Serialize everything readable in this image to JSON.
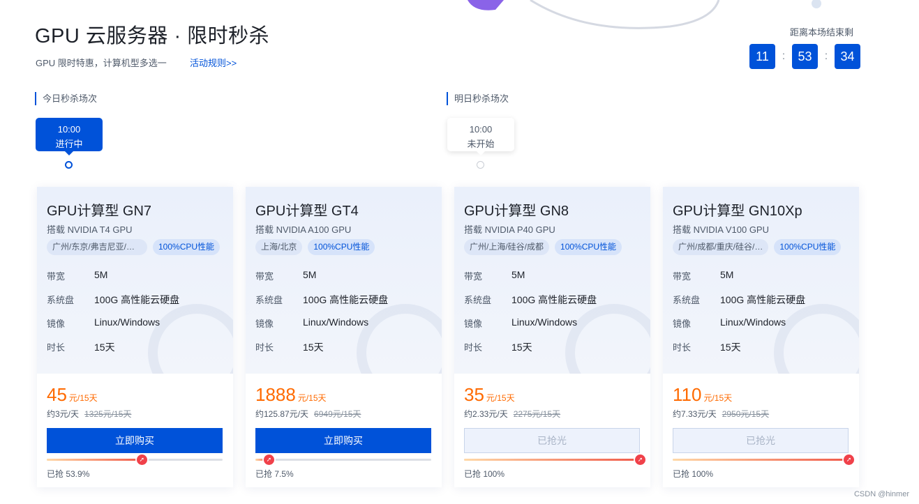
{
  "header": {
    "title": "GPU 云服务器 · 限时秒杀",
    "subtitle": "GPU 限时特惠，计算机型多选一",
    "rules_link": "活动规则>>"
  },
  "countdown": {
    "label": "距离本场结束剩",
    "hours": "11",
    "minutes": "53",
    "seconds": "34",
    "separator": ":"
  },
  "sessions": [
    {
      "label": "今日秒杀场次",
      "time": "10:00",
      "status": "进行中",
      "active": true
    },
    {
      "label": "明日秒杀场次",
      "time": "10:00",
      "status": "未开始",
      "active": false
    }
  ],
  "spec_labels": {
    "bandwidth": "带宽",
    "disk": "系统盘",
    "image": "镜像",
    "duration": "时长"
  },
  "cards": [
    {
      "name": "GPU计算型 GN7",
      "gpu": "搭载 NVIDIA T4 GPU",
      "region_tag": "广州/东京/弗吉尼亚/曼谷",
      "perf_tag": "100%CPU性能",
      "bandwidth": "5M",
      "disk": "100G 高性能云硬盘",
      "image": "Linux/Windows",
      "duration": "15天",
      "price": "45",
      "unit": "元/15天",
      "per_day": "约3元/天",
      "original": "1325元/15天",
      "button": "立即购买",
      "button_state": "buy",
      "progress": 0.539,
      "grabbed": "已抢 53.9%"
    },
    {
      "name": "GPU计算型 GT4",
      "gpu": "搭载 NVIDIA A100 GPU",
      "region_tag": "上海/北京",
      "perf_tag": "100%CPU性能",
      "bandwidth": "5M",
      "disk": "100G 高性能云硬盘",
      "image": "Linux/Windows",
      "duration": "15天",
      "price": "1888",
      "unit": "元/15天",
      "per_day": "约125.87元/天",
      "original": "6949元/15天",
      "button": "立即购买",
      "button_state": "buy",
      "progress": 0.075,
      "grabbed": "已抢 7.5%"
    },
    {
      "name": "GPU计算型 GN8",
      "gpu": "搭载 NVIDIA P40 GPU",
      "region_tag": "广州/上海/硅谷/成都",
      "perf_tag": "100%CPU性能",
      "bandwidth": "5M",
      "disk": "100G 高性能云硬盘",
      "image": "Linux/Windows",
      "duration": "15天",
      "price": "35",
      "unit": "元/15天",
      "per_day": "约2.33元/天",
      "original": "2275元/15天",
      "button": "已抢光",
      "button_state": "sold",
      "progress": 1.0,
      "grabbed": "已抢 100%"
    },
    {
      "name": "GPU计算型 GN10Xp",
      "gpu": "搭载 NVIDIA V100 GPU",
      "region_tag": "广州/成都/重庆/硅谷/…",
      "perf_tag": "100%CPU性能",
      "bandwidth": "5M",
      "disk": "100G 高性能云硬盘",
      "image": "Linux/Windows",
      "duration": "15天",
      "price": "110",
      "unit": "元/15天",
      "per_day": "约7.33元/天",
      "original": "2950元/15天",
      "button": "已抢光",
      "button_state": "sold",
      "progress": 1.0,
      "grabbed": "已抢 100%"
    }
  ],
  "watermark_text": "CSDN @hinmer",
  "colors": {
    "primary": "#0052d9",
    "price": "#ff6a00",
    "progress_end": "#f05a4a"
  }
}
